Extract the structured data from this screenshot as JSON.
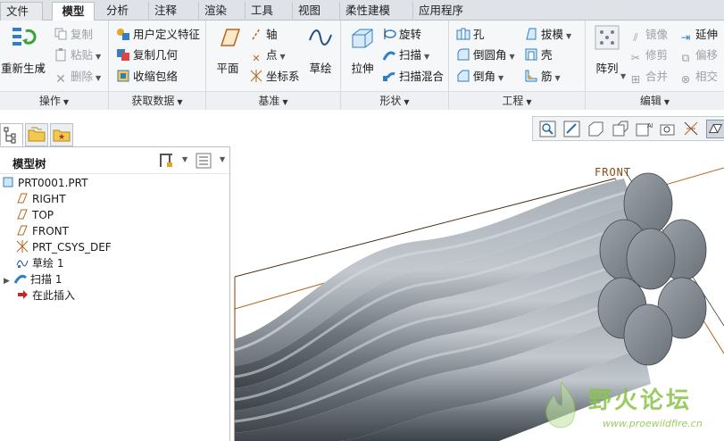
{
  "tabs": {
    "file": "文件",
    "model": "模型",
    "analysis": "分析",
    "annotate": "注释",
    "render": "渲染",
    "tools": "工具",
    "view": "视图",
    "flexible_modeling": "柔性建模",
    "applications": "应用程序"
  },
  "ribbon": {
    "operations": {
      "regenerate": "重新生成",
      "copy": "复制",
      "paste": "粘贴",
      "delete": "删除",
      "footer": "操作"
    },
    "get_data": {
      "udf": "用户定义特征",
      "copy_geometry": "复制几何",
      "shrinkwrap": "收缩包络",
      "footer": "获取数据"
    },
    "datum": {
      "plane": "平面",
      "axis": "轴",
      "point": "点",
      "csys": "坐标系",
      "sketch": "草绘",
      "footer": "基准"
    },
    "shapes": {
      "extrude": "拉伸",
      "revolve": "旋转",
      "sweep": "扫描",
      "swept_blend": "扫描混合",
      "footer": "形状"
    },
    "engineering": {
      "hole": "孔",
      "round": "倒圆角",
      "chamfer": "倒角",
      "draft": "拔模",
      "shell": "壳",
      "rib": "筋",
      "footer": "工程"
    },
    "editing": {
      "pattern": "阵列",
      "mirror": "镜像",
      "trim": "修剪",
      "merge": "合并",
      "extend": "延伸",
      "offset": "偏移",
      "intersect": "相交",
      "footer": "编辑"
    }
  },
  "model_tree": {
    "title": "模型树",
    "items": [
      {
        "label": "PRT0001.PRT",
        "icon": "part-icon"
      },
      {
        "label": "RIGHT",
        "icon": "datum-plane-icon"
      },
      {
        "label": "TOP",
        "icon": "datum-plane-icon"
      },
      {
        "label": "FRONT",
        "icon": "datum-plane-icon"
      },
      {
        "label": "PRT_CSYS_DEF",
        "icon": "csys-icon"
      },
      {
        "label": "草绘 1",
        "icon": "sketch-icon"
      },
      {
        "label": "扫描 1",
        "icon": "sweep-icon"
      },
      {
        "label": "在此插入",
        "icon": "insert-here-icon"
      }
    ]
  },
  "viewport": {
    "datum_label": "FRONT"
  },
  "watermark": {
    "title": "野火论坛",
    "url": "www.proewildfire.cn"
  },
  "colors": {
    "accent": "#1f6fb2",
    "datum_plane": "#b5651d",
    "rope_gray": "#808890",
    "watermark_green": "#7fc23a"
  }
}
